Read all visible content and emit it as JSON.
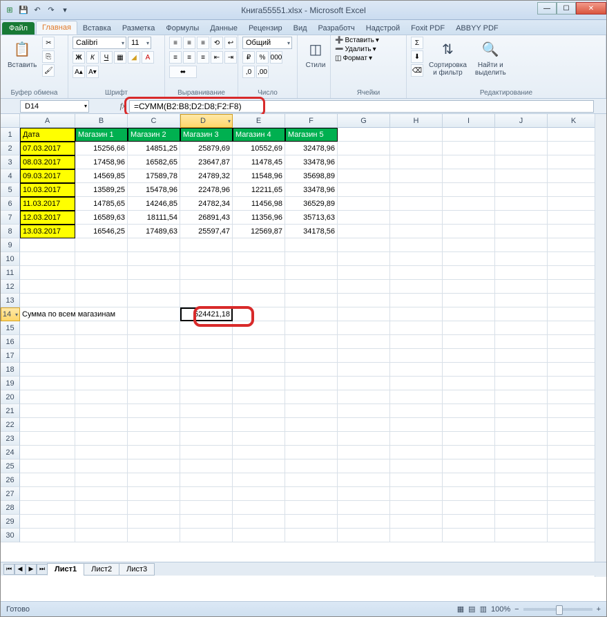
{
  "window": {
    "title": "Книга55551.xlsx - Microsoft Excel"
  },
  "tabs": {
    "file": "Файл",
    "items": [
      "Главная",
      "Вставка",
      "Разметка",
      "Формулы",
      "Данные",
      "Рецензир",
      "Вид",
      "Разработч",
      "Надстрой",
      "Foxit PDF",
      "ABBYY PDF"
    ],
    "active": 0
  },
  "ribbon": {
    "clipboard": {
      "paste": "Вставить",
      "label": "Буфер обмена"
    },
    "font": {
      "name": "Calibri",
      "size": "11",
      "label": "Шрифт"
    },
    "align": {
      "label": "Выравнивание"
    },
    "number": {
      "format": "Общий",
      "label": "Число"
    },
    "styles": {
      "btn": "Стили",
      "label": ""
    },
    "cells": {
      "insert": "Вставить",
      "delete": "Удалить",
      "format": "Формат",
      "label": "Ячейки"
    },
    "editing": {
      "sort": "Сортировка\nи фильтр",
      "find": "Найти и\nвыделить",
      "label": "Редактирование"
    }
  },
  "namebox": "D14",
  "formula": "=СУММ(B2:B8;D2:D8;F2:F8)",
  "columns": [
    "A",
    "B",
    "C",
    "D",
    "E",
    "F",
    "G",
    "H",
    "I",
    "J",
    "K"
  ],
  "headers": [
    "Дата",
    "Магазин 1",
    "Магазин 2",
    "Магазин 3",
    "Магазин 4",
    "Магазин 5"
  ],
  "data_rows": [
    [
      "07.03.2017",
      "15256,66",
      "14851,25",
      "25879,69",
      "10552,69",
      "32478,96"
    ],
    [
      "08.03.2017",
      "17458,96",
      "16582,65",
      "23647,87",
      "11478,45",
      "33478,96"
    ],
    [
      "09.03.2017",
      "14569,85",
      "17589,78",
      "24789,32",
      "11548,96",
      "35698,89"
    ],
    [
      "10.03.2017",
      "13589,25",
      "15478,96",
      "22478,96",
      "12211,65",
      "33478,96"
    ],
    [
      "11.03.2017",
      "14785,65",
      "14246,85",
      "24782,34",
      "11456,98",
      "36529,89"
    ],
    [
      "12.03.2017",
      "16589,63",
      "18111,54",
      "26891,43",
      "11356,96",
      "35713,63"
    ],
    [
      "13.03.2017",
      "16546,25",
      "17489,63",
      "25597,47",
      "12569,87",
      "34178,56"
    ]
  ],
  "sum_label": "Сумма по всем магазинам",
  "sum_value": "524421,18",
  "sheets": [
    "Лист1",
    "Лист2",
    "Лист3"
  ],
  "status": {
    "ready": "Готово",
    "zoom": "100%"
  }
}
